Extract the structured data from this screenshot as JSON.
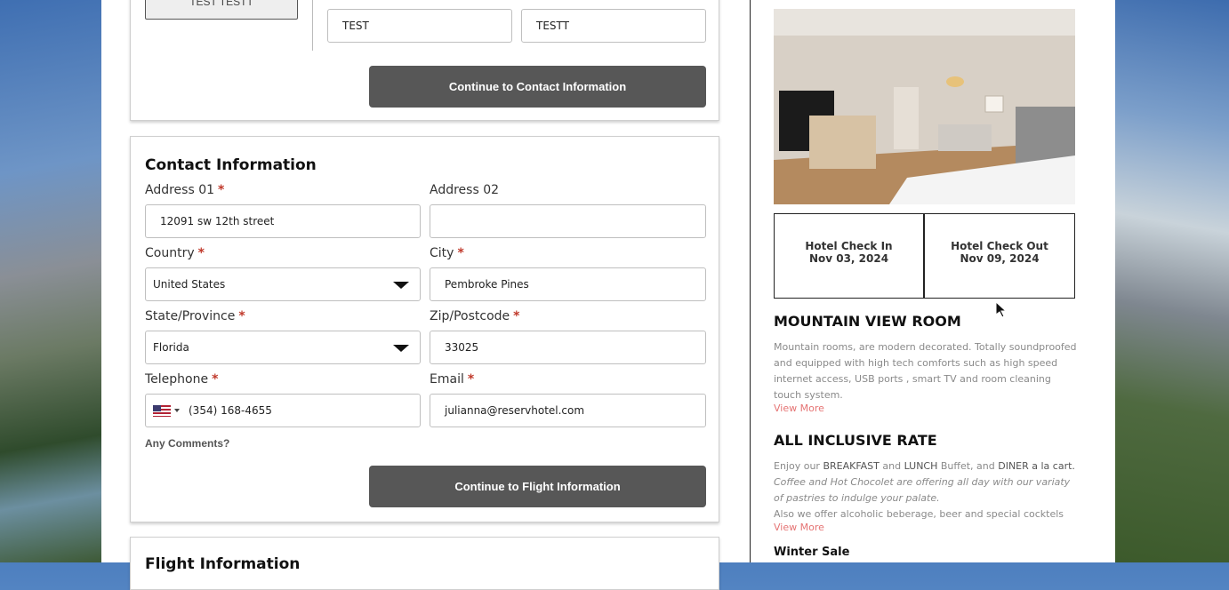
{
  "guest": {
    "name_badge": "TEST TESTT",
    "first_name": "TEST",
    "last_name": "TESTT",
    "continue_label": "Continue to Contact Information"
  },
  "contact": {
    "title": "Contact Information",
    "address1_label": "Address 01",
    "address1_value": "12091 sw 12th street",
    "address2_label": "Address 02",
    "address2_value": "",
    "country_label": "Country",
    "country_value": "United States",
    "city_label": "City",
    "city_value": "Pembroke Pines",
    "state_label": "State/Province",
    "state_value": "Florida",
    "zip_label": "Zip/Postcode",
    "zip_value": "33025",
    "phone_label": "Telephone",
    "phone_value": "(354) 168-4655",
    "email_label": "Email",
    "email_value": "julianna@reservhotel.com",
    "comments_label": "Any Comments?",
    "required_mark": "*",
    "continue_label": "Continue to Flight Information"
  },
  "flight": {
    "title": "Flight Information"
  },
  "hotel": {
    "check_in_label": "Hotel Check In",
    "check_in_date": "Nov 03, 2024",
    "check_out_label": "Hotel Check Out",
    "check_out_date": "Nov 09, 2024",
    "room_title": "MOUNTAIN VIEW ROOM",
    "room_desc": "Mountain rooms, are modern decorated.  Totally soundproofed and equipped with high tech comforts such as high speed internet access, USB ports , smart TV and room cleaning touch system.",
    "view_more": "View More",
    "rate_title": "ALL INCLUSIVE RATE",
    "rate_line1_a": "Enjoy our ",
    "rate_line1_b": "BREAKFAST",
    "rate_line1_c": " and ",
    "rate_line1_d": "LUNCH",
    "rate_line1_e": " Buffet, and ",
    "rate_line1_f": "DINER a la cart.",
    "rate_line2": "Coffee and Hot Chocolet are offering all day with our variaty of pastries to indulge your palate.",
    "rate_line3": "Also we offer alcoholic beberage, beer and special cocktels",
    "rate_view_more": "View More",
    "promo_title": "Winter Sale"
  },
  "colors": {
    "button_bg": "#575757",
    "required": "#c0392b",
    "link": "#e57373"
  },
  "icons": {
    "flag": "us-flag-icon",
    "dropdown": "caret-down-icon",
    "cursor": "mouse-pointer-icon"
  }
}
